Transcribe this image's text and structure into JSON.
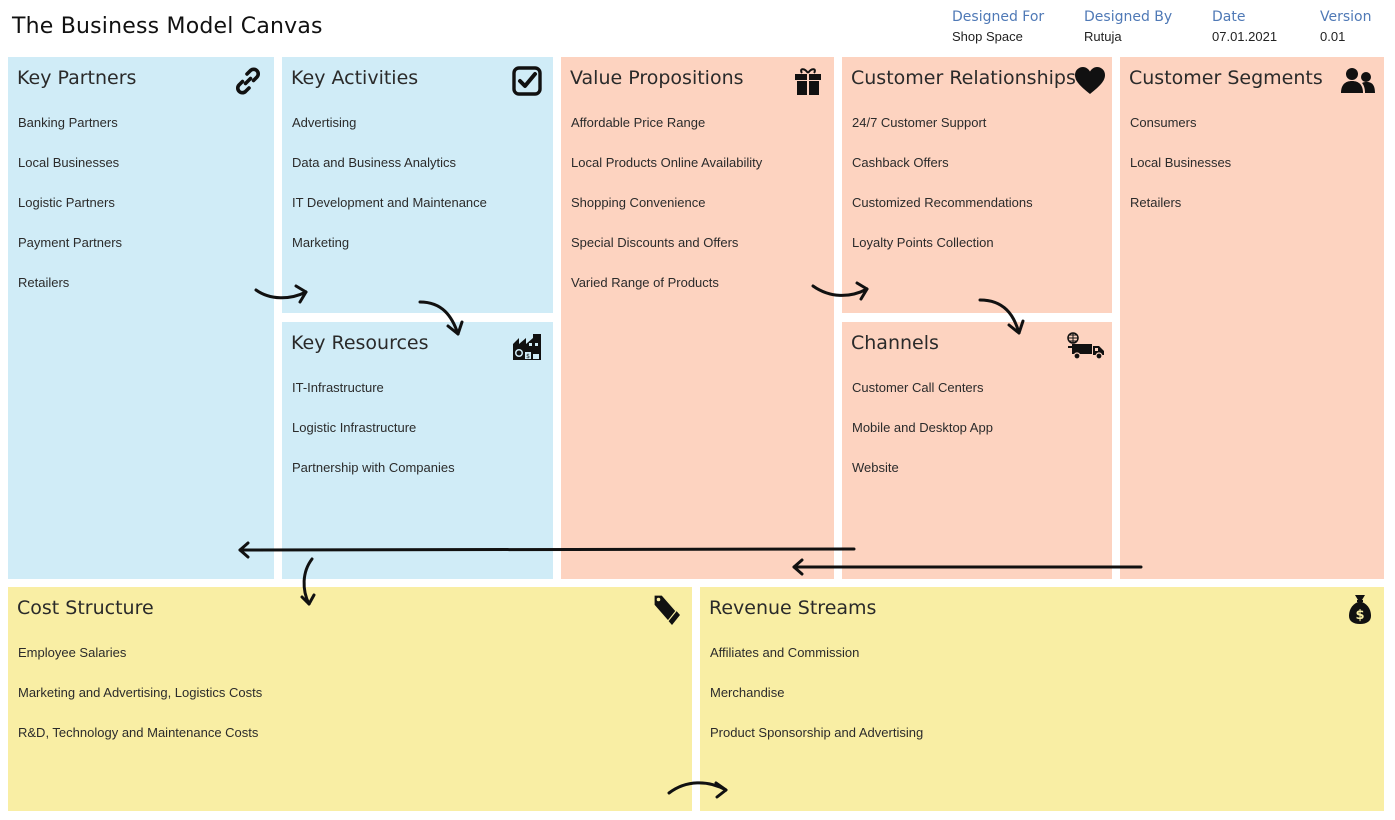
{
  "header": {
    "title": "The Business Model Canvas",
    "meta": [
      {
        "label": "Designed For",
        "value": "Shop Space"
      },
      {
        "label": "Designed By",
        "value": "Rutuja"
      },
      {
        "label": "Date",
        "value": "07.01.2021"
      },
      {
        "label": "Version",
        "value": "0.01"
      }
    ]
  },
  "colors": {
    "blue": "#d0ecf7",
    "peach": "#fdd3c0",
    "yellow": "#f9eea4",
    "meta_label": "#4f79b6"
  },
  "blocks": {
    "key_partners": {
      "title": "Key Partners",
      "icon": "link-icon",
      "items": [
        "Banking Partners",
        "Local Businesses",
        "Logistic Partners",
        "Payment Partners",
        "Retailers"
      ]
    },
    "key_activities": {
      "title": "Key Activities",
      "icon": "checkbox-icon",
      "items": [
        "Advertising",
        "Data and Business Analytics",
        "IT Development and Maintenance",
        "Marketing"
      ]
    },
    "key_resources": {
      "title": "Key Resources",
      "icon": "factory-icon",
      "items": [
        "IT-Infrastructure",
        "Logistic Infrastructure",
        "Partnership with Companies"
      ]
    },
    "value_propositions": {
      "title": "Value Propositions",
      "icon": "gift-icon",
      "items": [
        "Affordable Price Range",
        "Local Products Online Availability",
        "Shopping Convenience",
        "Special Discounts and Offers",
        "Varied Range of Products"
      ]
    },
    "customer_relationships": {
      "title": "Customer Relationships",
      "icon": "heart-icon",
      "items": [
        "24/7 Customer Support",
        "Cashback Offers",
        "Customized Recommendations",
        "Loyalty Points Collection"
      ]
    },
    "channels": {
      "title": "Channels",
      "icon": "delivery-truck-icon",
      "items": [
        "Customer Call Centers",
        "Mobile and Desktop App",
        "Website"
      ]
    },
    "customer_segments": {
      "title": "Customer Segments",
      "icon": "users-icon",
      "items": [
        "Consumers",
        "Local Businesses",
        "Retailers"
      ]
    },
    "cost_structure": {
      "title": "Cost Structure",
      "icon": "price-tag-icon",
      "items": [
        "Employee Salaries",
        "Marketing and Advertising, Logistics Costs",
        "R&D, Technology and Maintenance Costs"
      ]
    },
    "revenue_streams": {
      "title": "Revenue Streams",
      "icon": "money-bag-icon",
      "items": [
        "Affiliates and Commission",
        "Merchandise",
        "Product Sponsorship and Advertising"
      ]
    }
  }
}
